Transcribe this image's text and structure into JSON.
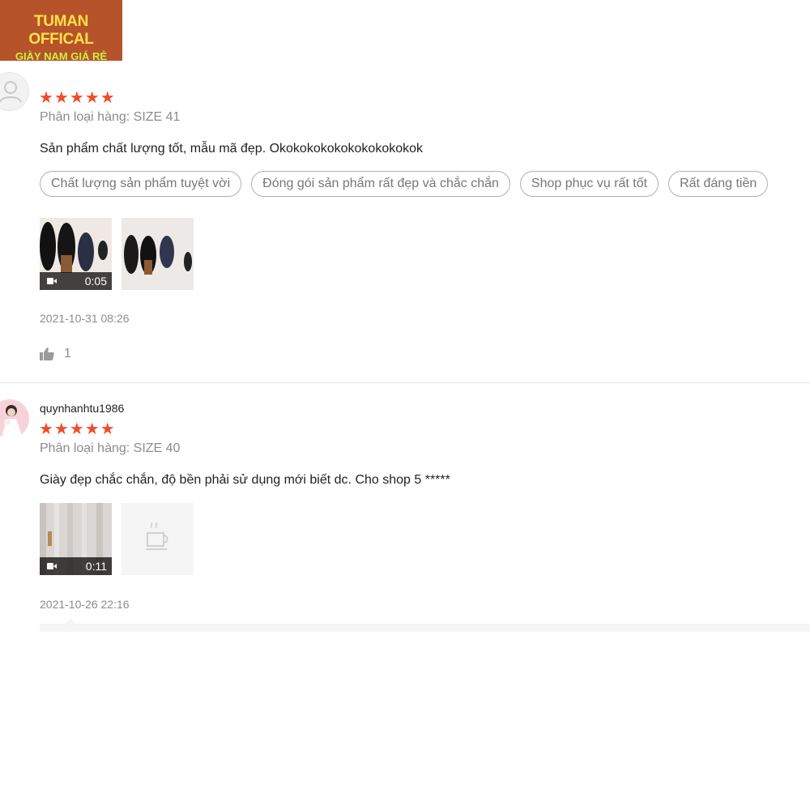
{
  "shop_logo": {
    "line1": "TUMAN OFFICAL",
    "line2": "GIÀY NAM GIÁ RẺ",
    "bg_color": "#b7532a",
    "line1_color": "#ffe14a",
    "line2_color": "#c8f23c"
  },
  "accent_color": "#ee4d2d",
  "reviews": [
    {
      "username": "",
      "avatar_icon": "default-user-icon",
      "rating": 5,
      "stars": "★★★★★",
      "variant": "Phân loại hàng: SIZE 41",
      "content": "Sản phẩm chất lượng tốt, mẫu mã đẹp. Okokokokokokokokokokok",
      "tags": [
        "Chất lượng sản phẩm tuyệt vời",
        "Đóng gói sản phẩm rất đẹp và chắc chắn",
        "Shop phục vụ rất tốt",
        "Rất đáng tiền"
      ],
      "media": [
        {
          "type": "video",
          "duration": "0:05",
          "icon": "video-camera-icon"
        },
        {
          "type": "image",
          "icon": "shoe-photo"
        }
      ],
      "date": "2021-10-31 08:26",
      "likes": "1",
      "like_icon": "thumbs-up-icon"
    },
    {
      "username": "quynhanhtu1986",
      "avatar_icon": "user-photo",
      "rating": 5,
      "stars": "★★★★★",
      "variant": "Phân loại hàng: SIZE 40",
      "content": "Giày đẹp chắc chắn, độ bền phải sử dụng mới biết dc. Cho shop 5 *****",
      "media": [
        {
          "type": "video",
          "duration": "0:11",
          "icon": "video-camera-icon"
        },
        {
          "type": "image-placeholder",
          "icon": "coffee-cup-placeholder-icon"
        }
      ],
      "date": "2021-10-26 22:16"
    }
  ]
}
